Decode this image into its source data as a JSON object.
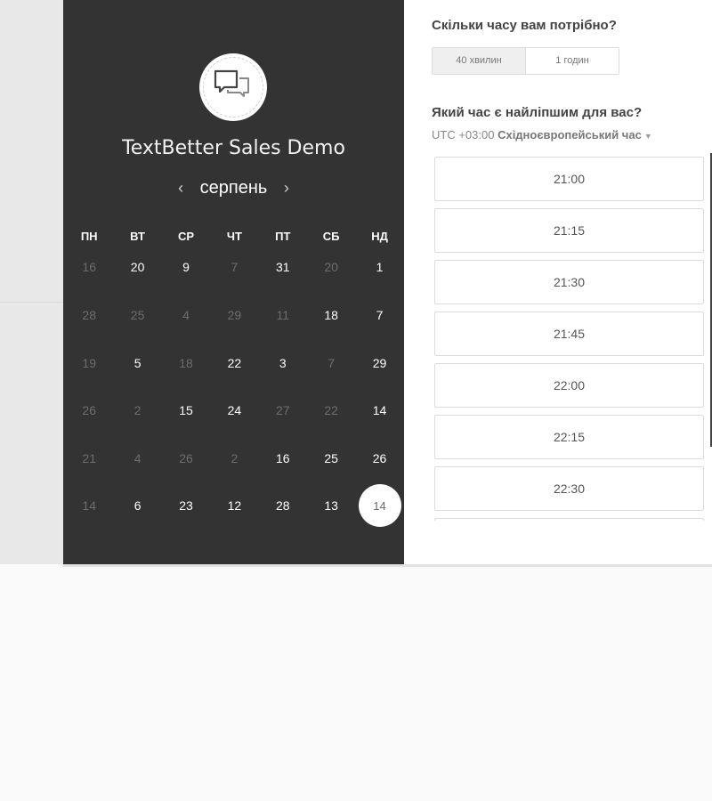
{
  "company": {
    "name": "TextBetter Sales Demo",
    "logo_icon": "chat-bubbles-icon"
  },
  "calendar": {
    "month": "серпень",
    "prev_icon": "‹",
    "next_icon": "›",
    "weekdays": [
      "ПН",
      "ВТ",
      "СР",
      "ЧТ",
      "ПТ",
      "СБ",
      "НД"
    ],
    "rows": [
      [
        {
          "d": "16",
          "m": true
        },
        {
          "d": "20",
          "m": false
        },
        {
          "d": "9",
          "m": false
        },
        {
          "d": "7",
          "m": true
        },
        {
          "d": "31",
          "m": false
        },
        {
          "d": "20",
          "m": true
        },
        {
          "d": "1",
          "m": false
        }
      ],
      [
        {
          "d": "28",
          "m": true
        },
        {
          "d": "25",
          "m": true
        },
        {
          "d": "4",
          "m": true
        },
        {
          "d": "29",
          "m": true
        },
        {
          "d": "11",
          "m": true
        },
        {
          "d": "18",
          "m": false
        },
        {
          "d": "7",
          "m": false
        }
      ],
      [
        {
          "d": "19",
          "m": true
        },
        {
          "d": "5",
          "m": false
        },
        {
          "d": "18",
          "m": true
        },
        {
          "d": "22",
          "m": false
        },
        {
          "d": "3",
          "m": false
        },
        {
          "d": "7",
          "m": true
        },
        {
          "d": "29",
          "m": false
        }
      ],
      [
        {
          "d": "26",
          "m": true
        },
        {
          "d": "2",
          "m": true
        },
        {
          "d": "15",
          "m": false
        },
        {
          "d": "24",
          "m": false
        },
        {
          "d": "27",
          "m": true
        },
        {
          "d": "22",
          "m": true
        },
        {
          "d": "14",
          "m": false
        }
      ],
      [
        {
          "d": "21",
          "m": true
        },
        {
          "d": "4",
          "m": true
        },
        {
          "d": "26",
          "m": true
        },
        {
          "d": "2",
          "m": true
        },
        {
          "d": "16",
          "m": false
        },
        {
          "d": "25",
          "m": false
        },
        {
          "d": "26",
          "m": false
        }
      ],
      [
        {
          "d": "14",
          "m": true
        },
        {
          "d": "6",
          "m": false
        },
        {
          "d": "23",
          "m": false
        },
        {
          "d": "12",
          "m": false
        },
        {
          "d": "28",
          "m": false
        },
        {
          "d": "13",
          "m": false
        },
        {
          "d": "14",
          "m": false,
          "selected": true
        }
      ]
    ]
  },
  "booking": {
    "duration_question": "Скільки часу вам потрібно?",
    "durations": [
      "40 хвилин",
      "1 годин"
    ],
    "time_question": "Який час є найліпшим для вас?",
    "tz_offset": "UTC +03:00",
    "tz_name": "Східноєвропейський час",
    "slots": [
      "21:00",
      "21:15",
      "21:30",
      "21:45",
      "22:00",
      "22:15",
      "22:30",
      ""
    ]
  },
  "colors": {
    "dark_panel": "#333333",
    "muted_day": "#6d6d6d"
  }
}
